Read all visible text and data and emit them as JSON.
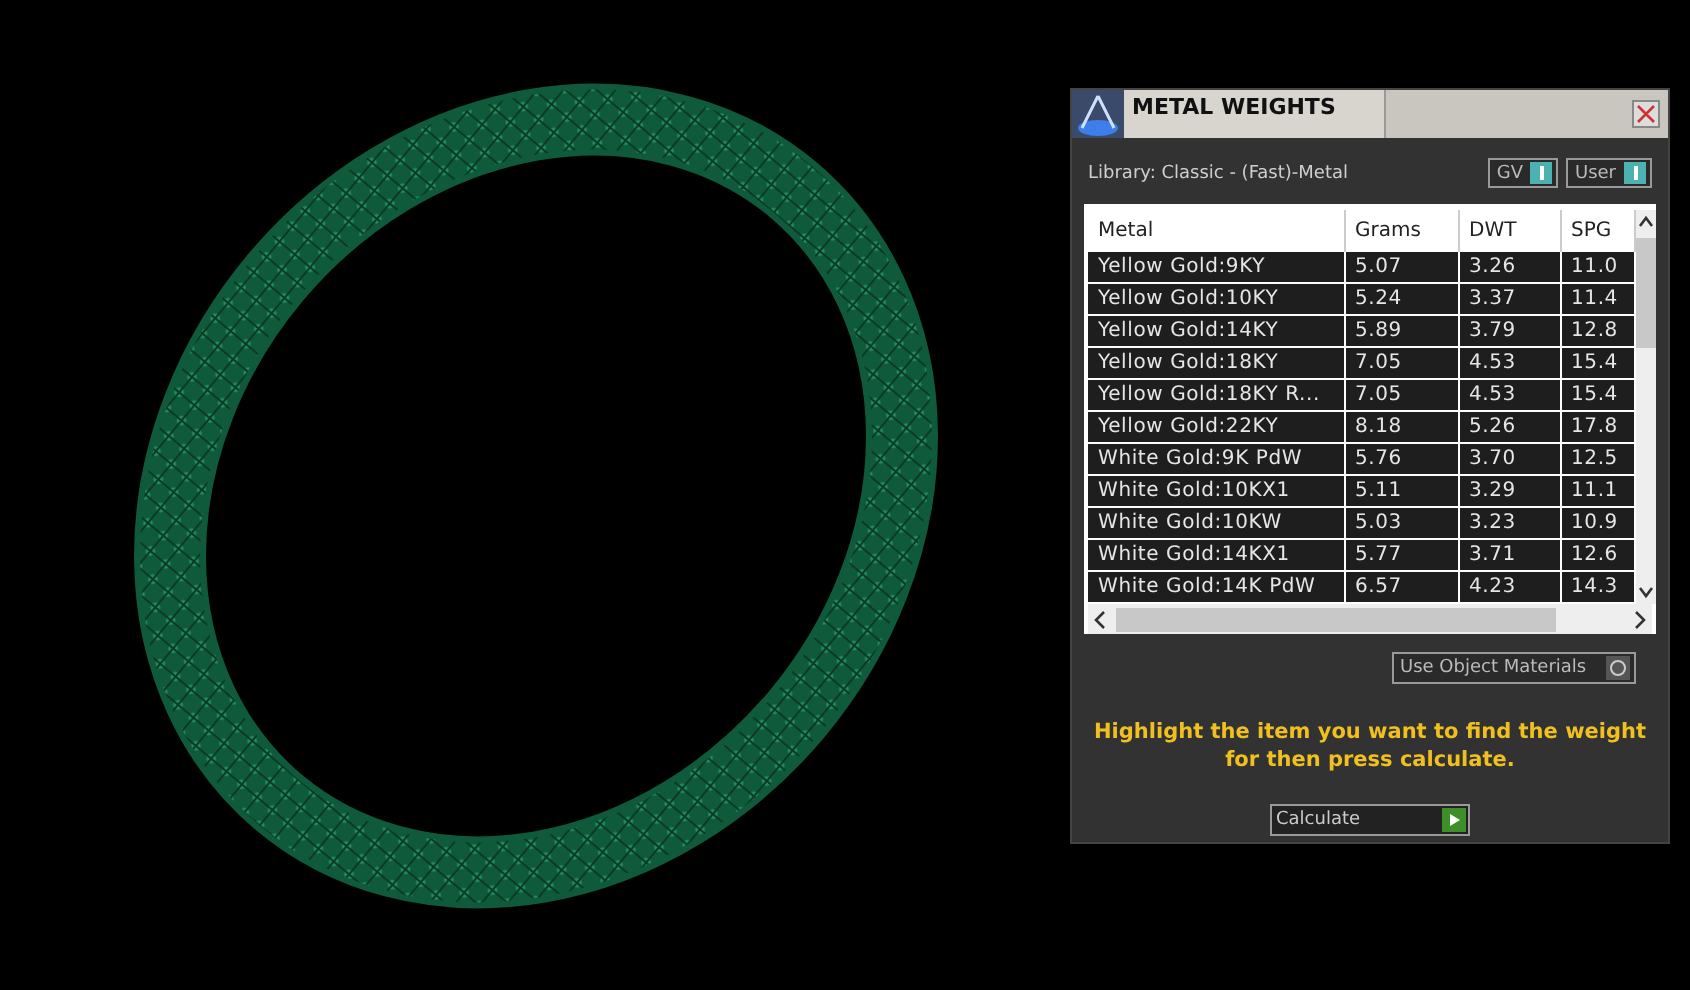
{
  "window": {
    "title": "METAL WEIGHTS"
  },
  "library": "Library: Classic - (Fast)-Metal",
  "toggles": [
    {
      "label": "GV",
      "on": true
    },
    {
      "label": "User",
      "on": true
    }
  ],
  "table": {
    "columns": [
      "Metal",
      "Grams",
      "DWT",
      "SPG"
    ],
    "rows": [
      [
        "Yellow Gold:9KY",
        "5.07",
        "3.26",
        "11.0"
      ],
      [
        "Yellow Gold:10KY",
        "5.24",
        "3.37",
        "11.4"
      ],
      [
        "Yellow Gold:14KY",
        "5.89",
        "3.79",
        "12.8"
      ],
      [
        "Yellow Gold:18KY",
        "7.05",
        "4.53",
        "15.4"
      ],
      [
        "Yellow Gold:18KY R...",
        "7.05",
        "4.53",
        "15.4"
      ],
      [
        "Yellow Gold:22KY",
        "8.18",
        "5.26",
        "17.8"
      ],
      [
        "White Gold:9K PdW",
        "5.76",
        "3.70",
        "12.5"
      ],
      [
        "White Gold:10KX1",
        "5.11",
        "3.29",
        "11.1"
      ],
      [
        "White Gold:10KW",
        "5.03",
        "3.23",
        "10.9"
      ],
      [
        "White Gold:14KX1",
        "5.77",
        "3.71",
        "12.6"
      ],
      [
        "White Gold:14K PdW",
        "6.57",
        "4.23",
        "14.3"
      ]
    ]
  },
  "use_object_materials": {
    "label": "Use Object Materials",
    "on": false
  },
  "hint": "Highlight the item you want to find the weight for then press calculate.",
  "calculate_button": "Calculate"
}
